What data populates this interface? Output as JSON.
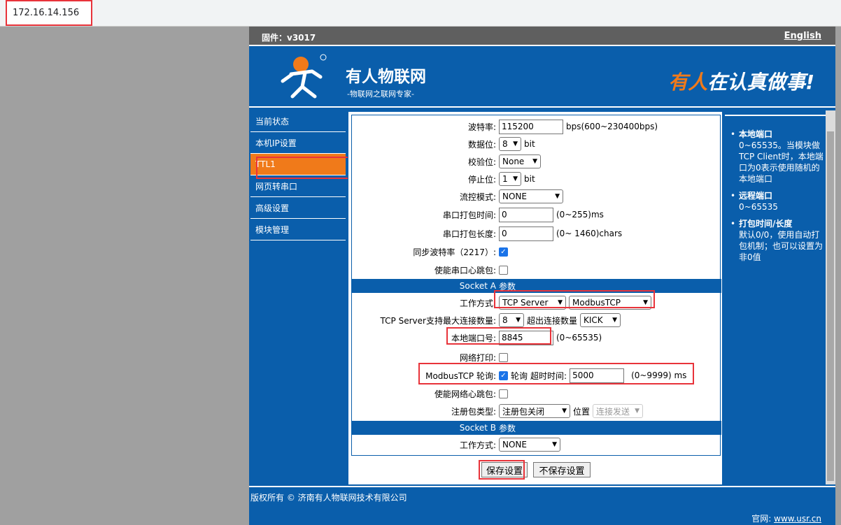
{
  "browser": {
    "url": "172.16.14.156"
  },
  "top": {
    "firmware": "固件：v3017",
    "language_link": "English"
  },
  "banner": {
    "brand": "有人物联网",
    "subtitle": "-物联网之联网专家-",
    "slogan_a": "有人",
    "slogan_b": "在认真做事!"
  },
  "nav": [
    {
      "label": "当前状态"
    },
    {
      "label": "本机IP设置"
    },
    {
      "label": "TTL1"
    },
    {
      "label": "网页转串口"
    },
    {
      "label": "高级设置"
    },
    {
      "label": "模块管理"
    }
  ],
  "form": {
    "baud_label": "波特率:",
    "baud_value": "115200",
    "baud_unit": "bps(600~230400bps)",
    "databits_label": "数据位:",
    "databits_value": "8",
    "databits_unit": "bit",
    "parity_label": "校验位:",
    "parity_value": "None",
    "stopbits_label": "停止位:",
    "stopbits_value": "1",
    "stopbits_unit": "bit",
    "flow_label": "流控模式:",
    "flow_value": "NONE",
    "packtime_label": "串口打包时间:",
    "packtime_value": "0",
    "packtime_unit": "(0~255)ms",
    "packlen_label": "串口打包长度:",
    "packlen_value": "0",
    "packlen_unit": "(0~ 1460)chars",
    "syncbaud_label": "同步波特率（2217）:",
    "serial_heartbeat_label": "使能串口心跳包:",
    "socketA_label": "Socket A",
    "socketA_param": "参数",
    "workmode_label": "工作方式:",
    "workmode_value": "TCP Server",
    "protocol_value": "ModbusTCP",
    "maxconn_label": "TCP Server支持最大连接数量:",
    "maxconn_value": "8",
    "overflow_label": "超出连接数量",
    "overflow_value": "KICK",
    "localport_label": "本地端口号:",
    "localport_value": "8845",
    "localport_range": "(0~65535)",
    "netprint_label": "网络打印:",
    "modbus_poll_label": "ModbusTCP 轮询:",
    "modbus_poll_text": "轮询",
    "timeout_label": "超时时间:",
    "timeout_value": "5000",
    "timeout_unit": "(0~9999) ms",
    "net_heartbeat_label": "使能网络心跳包:",
    "reg_label": "注册包类型:",
    "reg_value": "注册包关闭",
    "pos_label": "位置",
    "pos_value": "连接发送",
    "socketB_label": "Socket B",
    "socketB_param": "参数",
    "workmodeB_label": "工作方式:",
    "workmodeB_value": "NONE",
    "save": "保存设置",
    "nosave": "不保存设置"
  },
  "help": [
    {
      "title": "本地端口",
      "text": "0~65535。当模块做TCP Client时，本地端口为0表示使用随机的本地端口"
    },
    {
      "title": "远程端口",
      "text": "0~65535"
    },
    {
      "title": "打包时间/长度",
      "text": "默认0/0，使用自动打包机制；也可以设置为非0值"
    }
  ],
  "footer": {
    "copyright": "版权所有 © 济南有人物联网技术有限公司",
    "site_label": "官网:",
    "site_link": "www.usr.cn"
  },
  "colors": {
    "brand_blue": "#0a5eab",
    "orange": "#f07a1a",
    "highlight_red": "#e8333a"
  }
}
